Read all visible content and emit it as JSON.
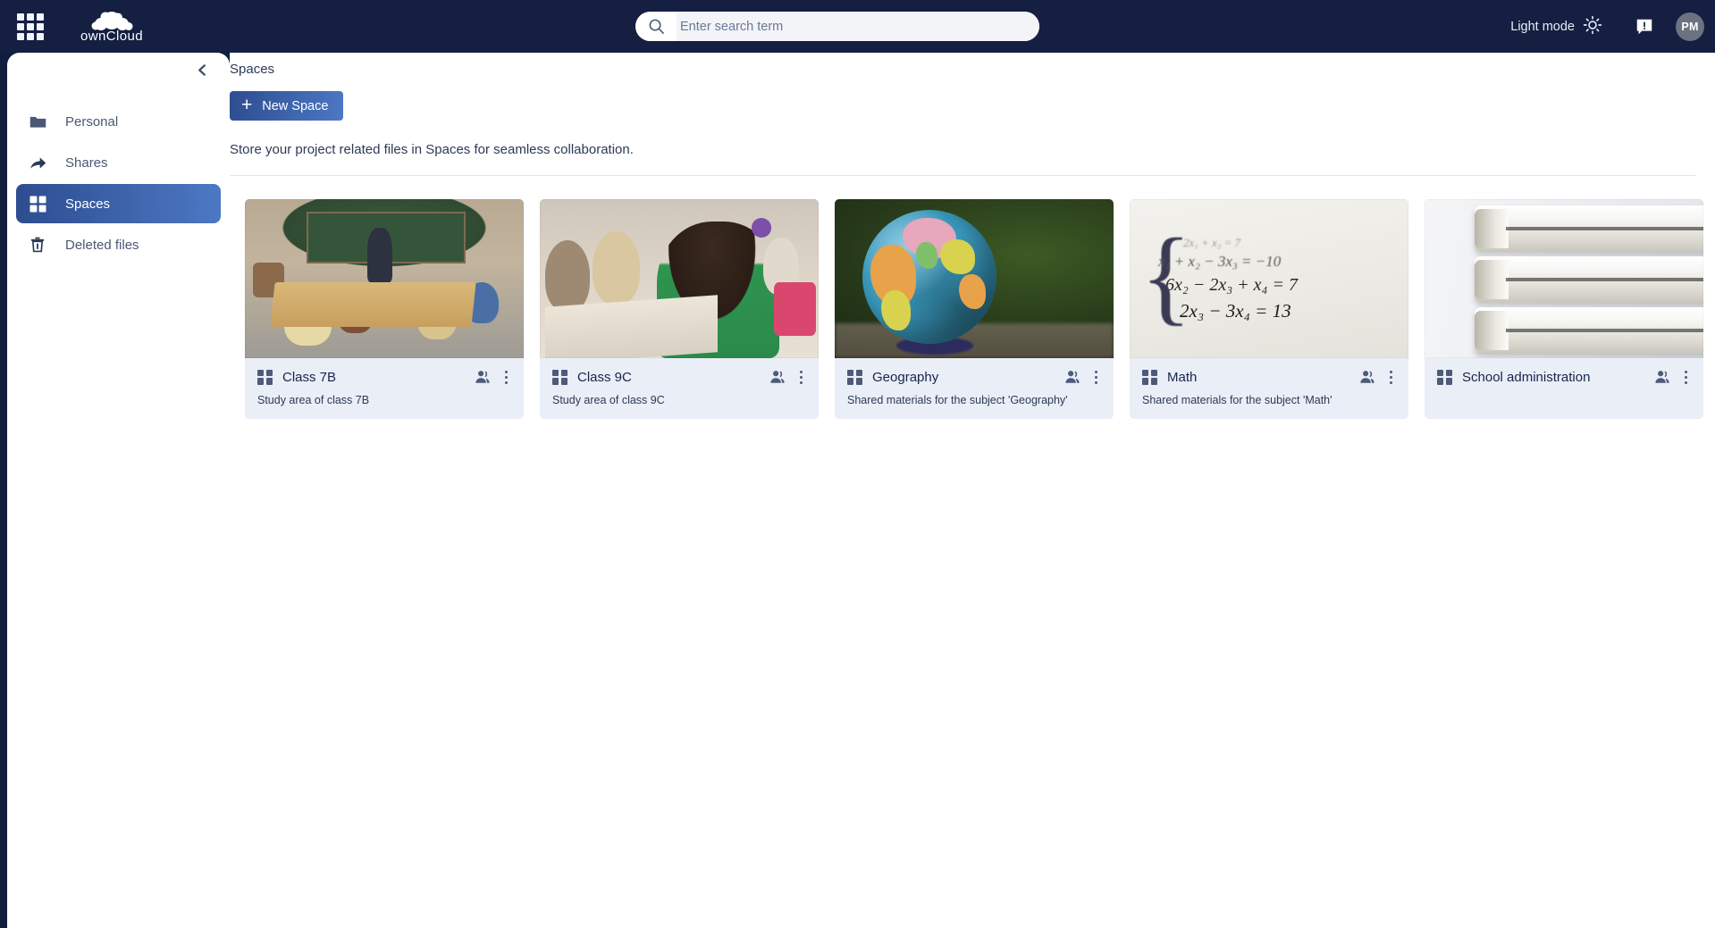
{
  "topbar": {
    "app_switcher_icon": "grid-apps-icon",
    "brand_name": "ownCloud",
    "search": {
      "icon": "search-icon",
      "placeholder": "Enter search term",
      "value": ""
    },
    "light_mode_label": "Light mode",
    "light_mode_icon": "sun-icon",
    "feedback_icon": "feedback-bubble-icon",
    "avatar_initials": "PM",
    "colors": {
      "bar_background": "#141f42",
      "avatar_background": "#6b7280"
    }
  },
  "sidebar": {
    "collapse_icon": "chevron-left-icon",
    "items": [
      {
        "label": "Personal",
        "icon": "folder-icon",
        "active": false
      },
      {
        "label": "Shares",
        "icon": "share-arrow-icon",
        "active": false
      },
      {
        "label": "Spaces",
        "icon": "grid-spaces-icon",
        "active": true
      },
      {
        "label": "Deleted files",
        "icon": "trash-icon",
        "active": false
      }
    ],
    "active_gradient": [
      "#2d4d8f",
      "#4d78c4"
    ]
  },
  "main": {
    "page_title": "Spaces",
    "new_space_button": {
      "label": "New Space",
      "icon": "plus-icon"
    },
    "blurb": "Store your project related files in Spaces for seamless collaboration.",
    "spaces": [
      {
        "name": "Class 7B",
        "description": "Study area of class 7B",
        "space_icon": "grid-spaces-icon",
        "members_icon": "people-icon",
        "menu_icon": "three-dots-vertical-icon",
        "thumbnail": "classroom-photo-class-7b"
      },
      {
        "name": "Class 9C",
        "description": "Study area of class 9C",
        "space_icon": "grid-spaces-icon",
        "members_icon": "people-icon",
        "menu_icon": "three-dots-vertical-icon",
        "thumbnail": "classroom-photo-class-9c"
      },
      {
        "name": "Geography",
        "description": "Shared materials for the subject 'Geography'",
        "space_icon": "grid-spaces-icon",
        "members_icon": "people-icon",
        "menu_icon": "three-dots-vertical-icon",
        "thumbnail": "globe-photo"
      },
      {
        "name": "Math",
        "description": "Shared materials for the subject 'Math'",
        "space_icon": "grid-spaces-icon",
        "members_icon": "people-icon",
        "menu_icon": "three-dots-vertical-icon",
        "thumbnail": "equations-photo",
        "thumbnail_text": [
          "2x₁ + x₂ = 7",
          "x₁ + x₂ − 3x₃ = −10",
          "6x₂ − 2x₃ + x₄ = 7",
          "2x₃ − 3x₄ = 13"
        ]
      },
      {
        "name": "School administration",
        "description": "",
        "space_icon": "grid-spaces-icon",
        "members_icon": "people-icon",
        "menu_icon": "three-dots-vertical-icon",
        "thumbnail": "binders-photo"
      }
    ]
  },
  "theme": {
    "accent": "#4d78c4",
    "card_background": "#eaeef7",
    "text_primary": "#16264a",
    "text_secondary": "#4a5875",
    "page_background": "#0f1e3d"
  }
}
